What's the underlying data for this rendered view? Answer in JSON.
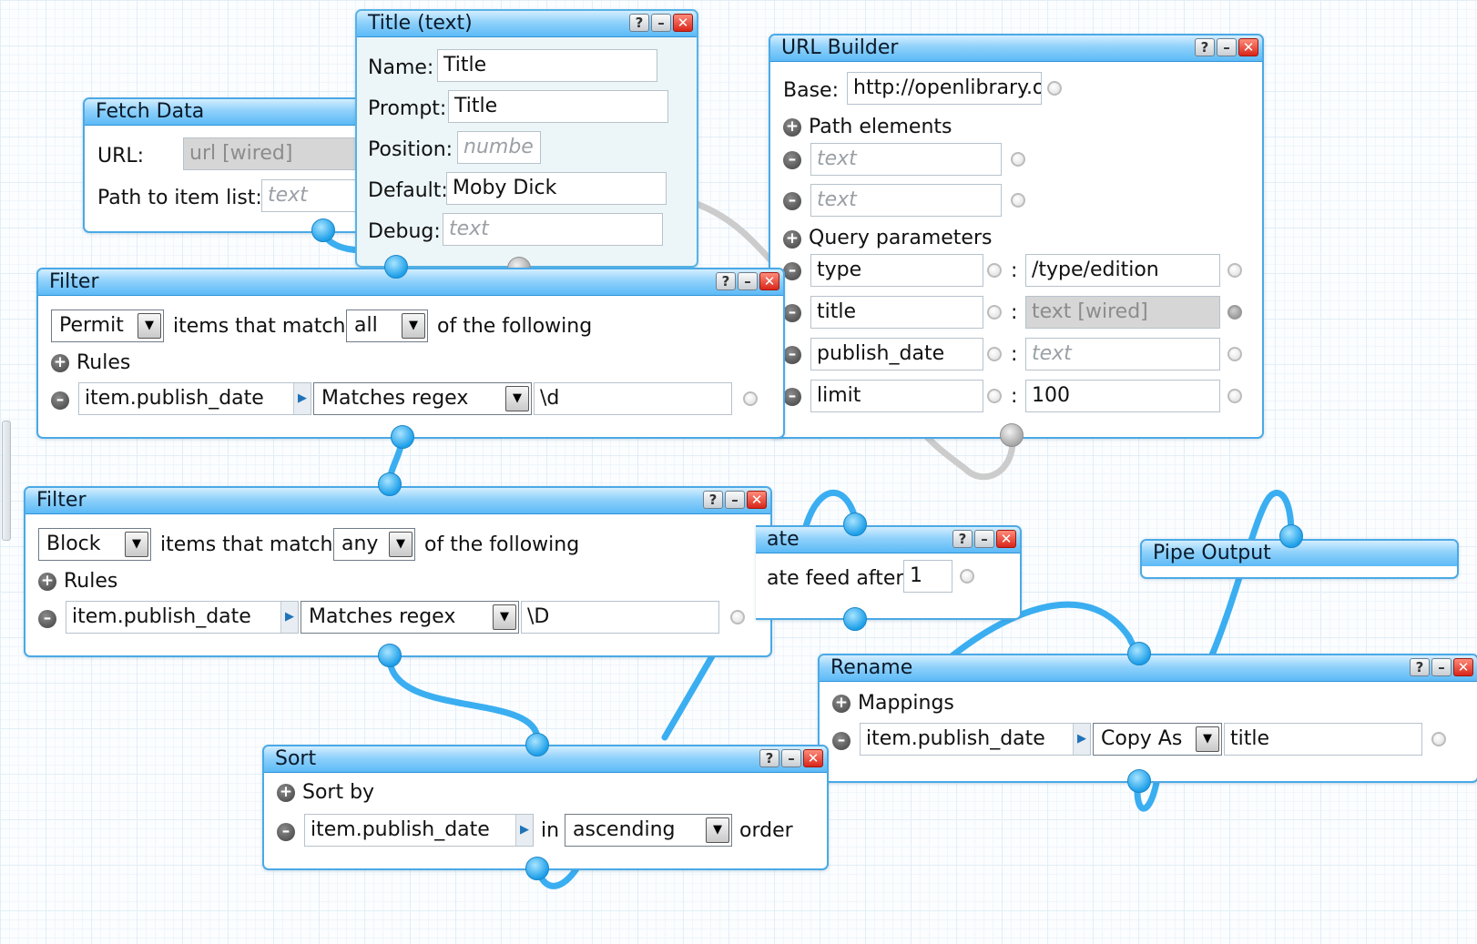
{
  "canvas": {
    "colors": {
      "wire": "#3aaef0",
      "wire_inactive": "#cccccc",
      "header": "#5cbaf6",
      "border": "#4aa9e6"
    }
  },
  "icons": {
    "help": "?",
    "minimize": "–",
    "close": "✕",
    "add": "+",
    "remove": "–",
    "dropdown": "▼",
    "field_menu": "▶"
  },
  "fetch_data": {
    "title": "Fetch Data",
    "url_label": "URL:",
    "url_value": "url [wired]",
    "path_label": "Path to item list:",
    "path_placeholder": "text"
  },
  "title_input": {
    "title": "Title (text)",
    "name_label": "Name:",
    "name_value": "Title",
    "prompt_label": "Prompt:",
    "prompt_value": "Title",
    "position_label": "Position:",
    "position_placeholder": "numbe",
    "default_label": "Default:",
    "default_value": "Moby Dick",
    "debug_label": "Debug:",
    "debug_placeholder": "text"
  },
  "url_builder": {
    "title": "URL Builder",
    "base_label": "Base:",
    "base_value": "http://openlibrary.or",
    "path_elements_label": "Path elements",
    "path_elements": [
      {
        "placeholder": "text"
      },
      {
        "placeholder": "text"
      }
    ],
    "query_parameters_label": "Query parameters",
    "query_parameters": [
      {
        "key": "type",
        "value": "/type/edition"
      },
      {
        "key": "title",
        "value": "text [wired]"
      },
      {
        "key": "publish_date",
        "value": "text"
      },
      {
        "key": "limit",
        "value": "100"
      }
    ],
    "separator": ":"
  },
  "filter_permit": {
    "title": "Filter",
    "mode": "Permit",
    "items_text": "items that match",
    "match": "all",
    "following_text": "of the following",
    "rules_label": "Rules",
    "rule": {
      "field": "item.publish_date",
      "operator": "Matches regex",
      "value": "\\d"
    }
  },
  "filter_block": {
    "title": "Filter",
    "mode": "Block",
    "items_text": "items that match",
    "match": "any",
    "following_text": "of the following",
    "rules_label": "Rules",
    "rule": {
      "field": "item.publish_date",
      "operator": "Matches regex",
      "value": "\\D"
    }
  },
  "truncate": {
    "title": "ate",
    "label": "ate feed after",
    "value": "1"
  },
  "pipe_output": {
    "title": "Pipe Output"
  },
  "rename": {
    "title": "Rename",
    "mappings_label": "Mappings",
    "mapping": {
      "field": "item.publish_date",
      "operation": "Copy As",
      "value": "title"
    }
  },
  "sort": {
    "title": "Sort",
    "sort_by_label": "Sort by",
    "field": "item.publish_date",
    "in_text": "in",
    "direction": "ascending",
    "order_text": "order"
  }
}
